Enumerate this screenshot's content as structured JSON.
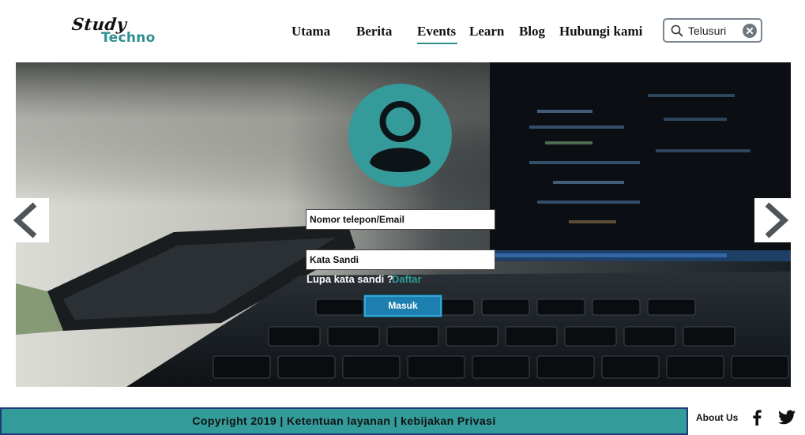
{
  "brand": {
    "line1": "Study",
    "line2": "Techno"
  },
  "nav": {
    "items": [
      {
        "label": "Utama",
        "active": false
      },
      {
        "label": "Berita",
        "active": false
      },
      {
        "label": "Events",
        "active": true
      },
      {
        "label": "Learn",
        "active": false
      },
      {
        "label": "Blog",
        "active": false
      },
      {
        "label": "Hubungi kami",
        "active": false
      }
    ]
  },
  "search": {
    "placeholder": "Telusuri"
  },
  "login": {
    "username_placeholder": "Nomor telepon/Email",
    "password_placeholder": "Kata Sandi",
    "forgot_label": "Lupa kata sandi ?",
    "register_label": "Daftar",
    "submit_label": "Masuk"
  },
  "footer": {
    "copyright": "Copyright 2019 | Ketentuan layanan | kebijakan Privasi",
    "about_label": "About Us"
  },
  "colors": {
    "accent": "#2f8f8f",
    "avatar": "#349a9a",
    "footer_bg": "#349b9b",
    "button": "#1d7fb0"
  },
  "icons": {
    "search": "search-icon",
    "clear": "close-circle-icon",
    "avatar": "user-avatar-icon",
    "prev": "chevron-left-icon",
    "next": "chevron-right-icon",
    "facebook": "facebook-icon",
    "twitter": "twitter-icon"
  }
}
